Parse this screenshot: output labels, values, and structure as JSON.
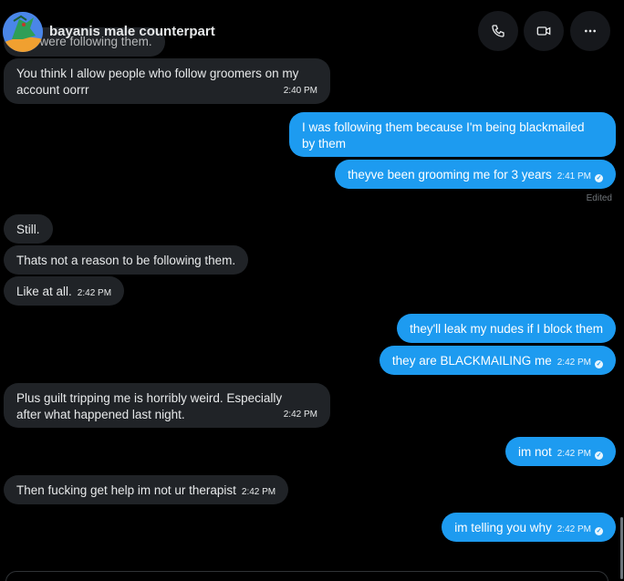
{
  "header": {
    "name": "bayanis male counterpart",
    "call_icon": "phone-icon",
    "video_icon": "video-camera-icon",
    "more_icon": "more-dots-icon"
  },
  "messages": [
    {
      "from": "them",
      "text": "you were following them."
    },
    {
      "from": "them",
      "line1": "You think I allow people who follow groomers on my",
      "line2": "account oorrr",
      "time": "2:40 PM"
    },
    {
      "from": "me",
      "line1": "I was following them because I'm being blackmailed",
      "line2": "by them"
    },
    {
      "from": "me",
      "text": "theyve been grooming me for 3 years",
      "time": "2:41 PM",
      "edited": "Edited"
    },
    {
      "from": "them",
      "text": "Still."
    },
    {
      "from": "them",
      "text": "Thats not a reason to be following them."
    },
    {
      "from": "them",
      "text": "Like at all.",
      "time": "2:42 PM"
    },
    {
      "from": "me",
      "text": "they'll leak my nudes if I block them"
    },
    {
      "from": "me",
      "text": "they are BLACKMAILING me",
      "time": "2:42 PM"
    },
    {
      "from": "them",
      "line1": "Plus guilt tripping me is horribly weird. Especially",
      "line2": "after what happened last night.",
      "time": "2:42 PM"
    },
    {
      "from": "me",
      "text": "im not",
      "time": "2:42 PM"
    },
    {
      "from": "them",
      "text": "Then fucking get help im not ur therapist",
      "time": "2:42 PM"
    },
    {
      "from": "me",
      "text": "im telling you why",
      "time": "2:42 PM"
    }
  ],
  "colors": {
    "background": "#000000",
    "incoming_bubble": "#202327",
    "outgoing_bubble": "#1d9bf0"
  }
}
